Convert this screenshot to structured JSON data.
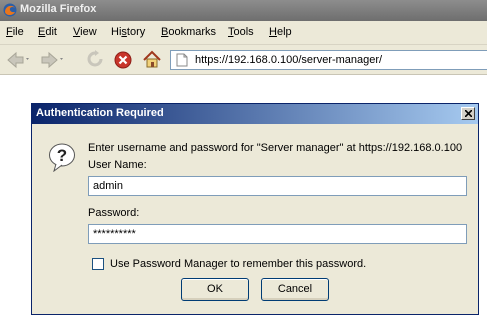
{
  "window": {
    "title": "Mozilla Firefox",
    "icon": "firefox-icon"
  },
  "menu": [
    {
      "label": "File",
      "accel": "F",
      "rest": "ile"
    },
    {
      "label": "Edit",
      "accel": "E",
      "rest": "dit"
    },
    {
      "label": "View",
      "accel": "V",
      "rest": "iew"
    },
    {
      "label": "History",
      "accel": "s",
      "pre": "Hi",
      "rest": "tory"
    },
    {
      "label": "Bookmarks",
      "accel": "B",
      "rest": "ookmarks"
    },
    {
      "label": "Tools",
      "accel": "T",
      "rest": "ools"
    },
    {
      "label": "Help",
      "accel": "H",
      "rest": "elp"
    }
  ],
  "nav": {
    "url": "https://192.168.0.100/server-manager/",
    "icons": [
      "back-icon",
      "forward-icon",
      "reload-icon",
      "stop-icon",
      "home-icon",
      "page-icon"
    ]
  },
  "dialog": {
    "title": "Authentication Required",
    "prompt": "Enter username and password for \"Server manager\" at https://192.168.0.100",
    "username_label": "User Name:",
    "username_value": "admin",
    "password_label": "Password:",
    "password_value": "**********",
    "remember_label": "Use Password Manager to remember this password.",
    "remember_checked": false,
    "ok_label": "OK",
    "cancel_label": "Cancel"
  },
  "colors": {
    "dialog_title_start": "#0a246a",
    "dialog_title_end": "#a6caf0",
    "stop_icon": "#c8352b"
  }
}
